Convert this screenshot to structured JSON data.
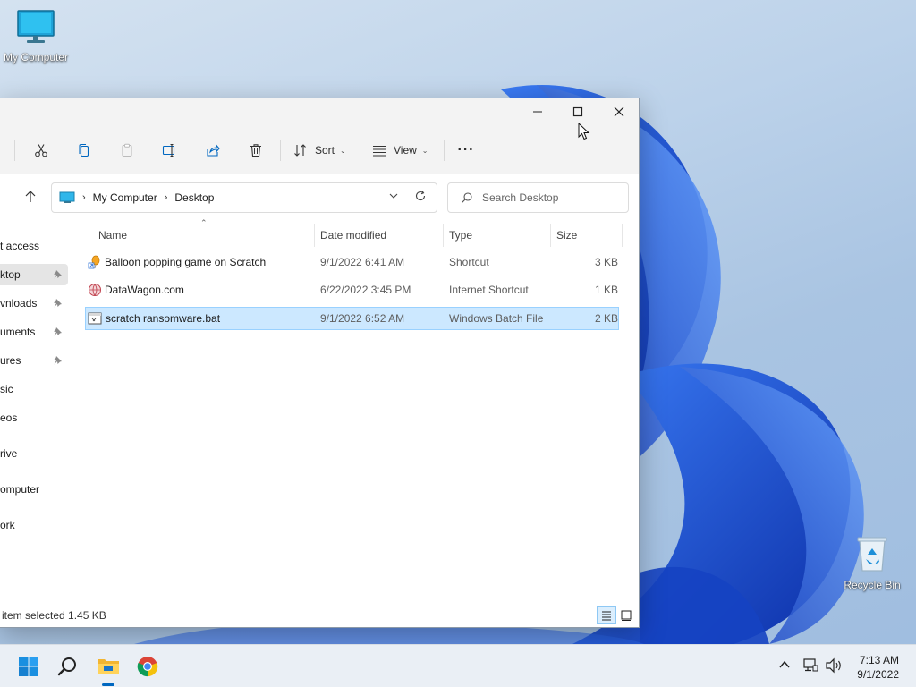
{
  "desktop": {
    "icons": [
      {
        "label": "My Computer",
        "icon": "monitor-icon"
      },
      {
        "label": "Recycle Bin",
        "icon": "recycle-bin-icon"
      }
    ]
  },
  "window": {
    "toolbar": {
      "sort_label": "Sort",
      "view_label": "View",
      "more_label": "···"
    },
    "address": {
      "crumbs": [
        "My Computer",
        "Desktop"
      ]
    },
    "search": {
      "placeholder": "Search Desktop"
    },
    "sidebar": {
      "items": [
        {
          "label": "Quick access",
          "visible_text": "t access",
          "pinned": false,
          "active": false
        },
        {
          "label": "Desktop",
          "visible_text": "ktop",
          "pinned": true,
          "active": true
        },
        {
          "label": "Downloads",
          "visible_text": "vnloads",
          "pinned": true,
          "active": false
        },
        {
          "label": "Documents",
          "visible_text": "uments",
          "pinned": true,
          "active": false
        },
        {
          "label": "Pictures",
          "visible_text": "ures",
          "pinned": true,
          "active": false
        },
        {
          "label": "Music",
          "visible_text": "sic",
          "pinned": false,
          "active": false
        },
        {
          "label": "Videos",
          "visible_text": "eos",
          "pinned": false,
          "active": false
        },
        {
          "label": "OneDrive",
          "visible_text": "rive",
          "pinned": false,
          "active": false
        },
        {
          "label": "My Computer",
          "visible_text": "omputer",
          "pinned": false,
          "active": false
        },
        {
          "label": "Network",
          "visible_text": "ork",
          "pinned": false,
          "active": false
        }
      ]
    },
    "columns": {
      "name": "Name",
      "date": "Date modified",
      "type": "Type",
      "size": "Size"
    },
    "files": [
      {
        "name": "Balloon popping game on Scratch",
        "date": "9/1/2022 6:41 AM",
        "type": "Shortcut",
        "size": "3 KB",
        "icon": "shortcut-icon",
        "selected": false
      },
      {
        "name": "DataWagon.com",
        "date": "6/22/2022 3:45 PM",
        "type": "Internet Shortcut",
        "size": "1 KB",
        "icon": "internet-shortcut-icon",
        "selected": false
      },
      {
        "name": "scratch ransomware.bat",
        "date": "9/1/2022 6:52 AM",
        "type": "Windows Batch File",
        "size": "2 KB",
        "icon": "batch-file-icon",
        "selected": true
      }
    ],
    "status": {
      "text": "item selected  1.45 KB"
    }
  },
  "taskbar": {
    "clock_time": "7:13 AM",
    "clock_date": "9/1/2022"
  },
  "colors": {
    "selection_bg": "#cce8ff",
    "selection_border": "#99d1ff",
    "accent": "#0067c0",
    "wallpaper_blue": "#1a4fd6"
  }
}
